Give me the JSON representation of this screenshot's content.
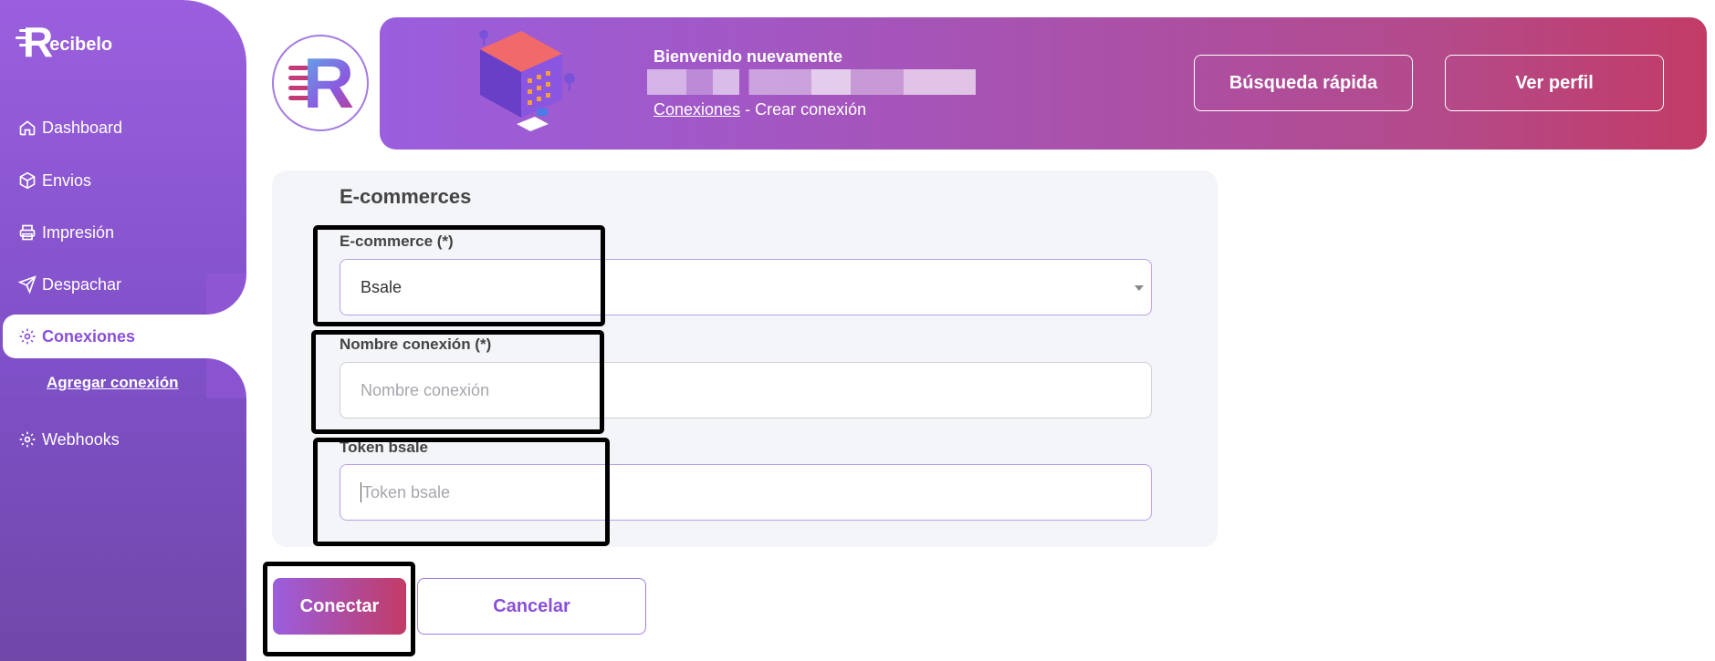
{
  "brand": {
    "name": "Recibelo",
    "mark": "R",
    "rest": "ecibelo"
  },
  "sidebar": {
    "items": [
      {
        "label": "Dashboard",
        "icon": "home-icon"
      },
      {
        "label": "Envios",
        "icon": "box-icon"
      },
      {
        "label": "Impresión",
        "icon": "printer-icon"
      },
      {
        "label": "Despachar",
        "icon": "send-icon"
      },
      {
        "label": "Conexiones",
        "icon": "gear-icon",
        "active": true
      },
      {
        "label": "Webhooks",
        "icon": "gear-icon"
      }
    ],
    "sub_item": "Agregar conexión"
  },
  "header": {
    "logo_letter": "R",
    "welcome": "Bienvenido nuevamente",
    "breadcrumb": {
      "link": "Conexiones",
      "separator": "-",
      "current": "Crear conexión"
    },
    "quick_search_label": "Búsqueda rápida",
    "profile_label": "Ver perfil"
  },
  "form": {
    "title": "E-commerces",
    "ecommerce": {
      "label": "E-commerce (*)",
      "value": "Bsale"
    },
    "connection_name": {
      "label": "Nombre conexión (*)",
      "placeholder": "Nombre conexión"
    },
    "token": {
      "label": "Token bsale",
      "placeholder": "Token bsale"
    }
  },
  "actions": {
    "connect": "Conectar",
    "cancel": "Cancelar"
  },
  "colors": {
    "accent_purple": "#9a5ede",
    "accent_magenta": "#c23b66",
    "active_text": "#8a4fd8",
    "card_bg": "#f4f5f9"
  }
}
